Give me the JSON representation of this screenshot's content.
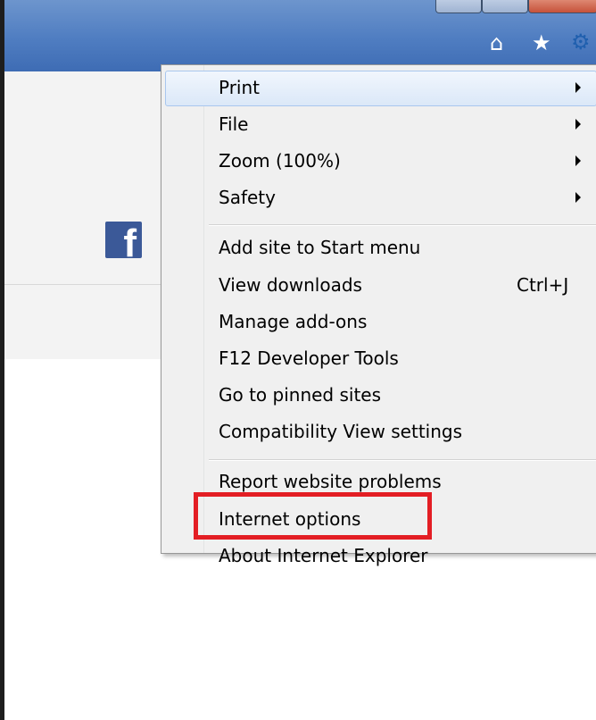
{
  "toolbar": {
    "home_icon": "home-icon",
    "favorites_icon": "star-icon",
    "tools_icon": "gear-icon"
  },
  "page": {
    "social_icon": "facebook-icon"
  },
  "menu": {
    "items": [
      {
        "label": "Print",
        "submenu": true
      },
      {
        "label": "File",
        "submenu": true
      },
      {
        "label": "Zoom (100%)",
        "submenu": true
      },
      {
        "label": "Safety",
        "submenu": true
      },
      {
        "label": "Add site to Start menu"
      },
      {
        "label": "View downloads",
        "shortcut": "Ctrl+J"
      },
      {
        "label": "Manage add-ons"
      },
      {
        "label": "F12 Developer Tools"
      },
      {
        "label": "Go to pinned sites"
      },
      {
        "label": "Compatibility View settings"
      },
      {
        "label": "Report website problems"
      },
      {
        "label": "Internet options"
      },
      {
        "label": "About Internet Explorer"
      }
    ]
  },
  "colors": {
    "titlebar": "#4f7dc1",
    "menu_bg": "#f0f0f0",
    "highlight": "#e31e24",
    "facebook": "#3b5998"
  }
}
